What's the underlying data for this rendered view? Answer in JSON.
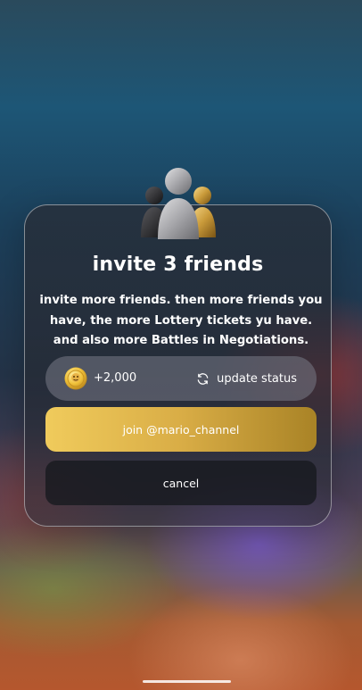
{
  "dialog": {
    "title": "invite 3 friends",
    "description": "invite more friends. then more friends you have, the more Lottery tickets yu have. and also more Battles in Negotiations.",
    "icon": "friends-group-icon"
  },
  "reward": {
    "icon": "coin-icon",
    "amount": "+2,000",
    "update_label": "update status",
    "update_icon": "refresh-icon"
  },
  "buttons": {
    "join_label": "join @mario_channel",
    "cancel_label": "cancel"
  },
  "colors": {
    "join_gradient_start": "#f0cb5c",
    "join_gradient_end": "#a98326",
    "card_border": "#ffffff"
  }
}
